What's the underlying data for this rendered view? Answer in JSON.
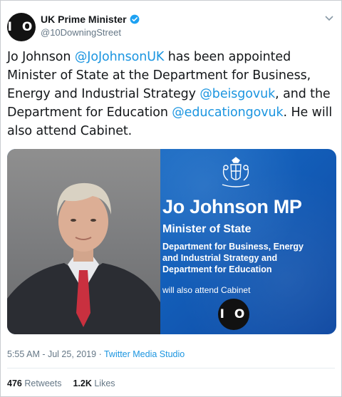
{
  "author": {
    "avatar_text": "I O",
    "display_name": "UK Prime Minister",
    "handle": "@10DowningStreet"
  },
  "tweet": {
    "seg1": "Jo Johnson ",
    "mention1": "@JoJohnsonUK",
    "seg2": " has been appointed Minister of State at the Department for Business, Energy and Industrial Strategy ",
    "mention2": "@beisgovuk",
    "seg3": ", and the Department for Education ",
    "mention3": "@educationgovuk",
    "seg4": ". He will also attend Cabinet."
  },
  "media": {
    "name": "Jo Johnson MP",
    "role": "Minister of State",
    "dept": "Department for Business, Energy and Industrial Strategy and Department for Education",
    "cabinet": "will also attend Cabinet",
    "logo_text": "I O"
  },
  "meta": {
    "time": "5:55 AM - Jul 25, 2019",
    "sep": " · ",
    "source": "Twitter Media Studio"
  },
  "stats": {
    "retweets_count": "476",
    "retweets_label": "Retweets",
    "likes_count": "1.2K",
    "likes_label": "Likes"
  },
  "colors": {
    "link": "#1b95e0",
    "verified": "#1da1f2",
    "card_blue": "#1565c0"
  }
}
